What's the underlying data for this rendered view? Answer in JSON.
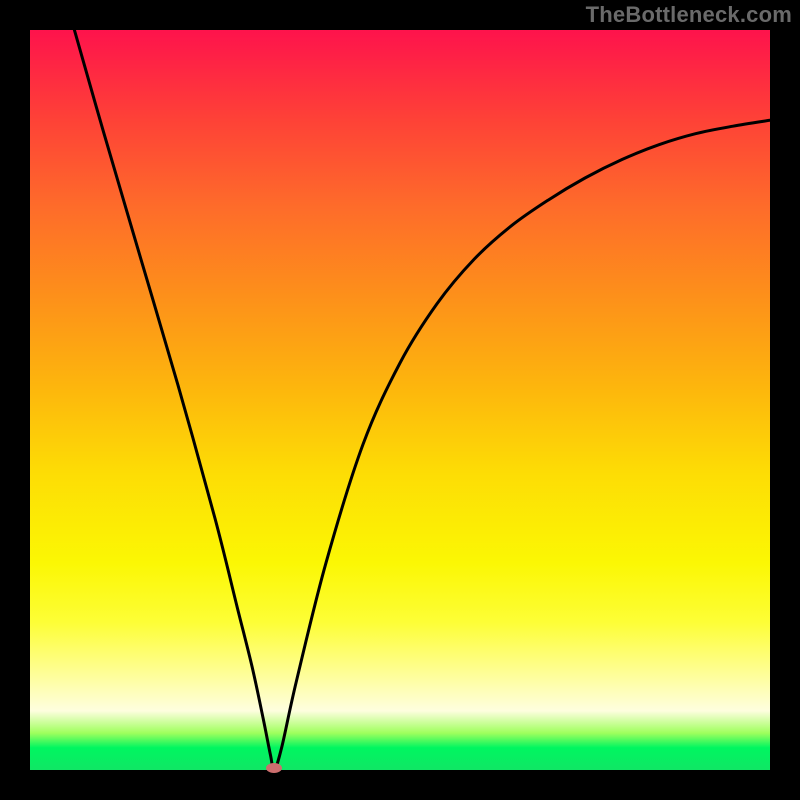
{
  "watermark": "TheBottleneck.com",
  "chart_data": {
    "type": "line",
    "title": "",
    "xlabel": "",
    "ylabel": "",
    "xlim": [
      0,
      100
    ],
    "ylim": [
      0,
      100
    ],
    "series": [
      {
        "name": "curve",
        "x": [
          6,
          10,
          15,
          20,
          25,
          28,
          30,
          31.5,
          32.5,
          33,
          34,
          36,
          40,
          45,
          50,
          55,
          60,
          65,
          70,
          75,
          80,
          85,
          90,
          95,
          100
        ],
        "y": [
          100,
          86,
          69,
          52,
          34,
          22,
          14,
          7,
          2,
          0,
          3,
          12,
          28,
          44,
          55,
          63,
          69,
          73.5,
          77,
          80,
          82.5,
          84.5,
          86,
          87,
          87.8
        ]
      }
    ],
    "minimum_point": {
      "x": 33,
      "y": 0
    },
    "background_gradient": {
      "top_color": "#fe134c",
      "bottom_color": "#10e665",
      "stops": [
        "red",
        "orange",
        "yellow",
        "pale-yellow",
        "green"
      ]
    }
  }
}
